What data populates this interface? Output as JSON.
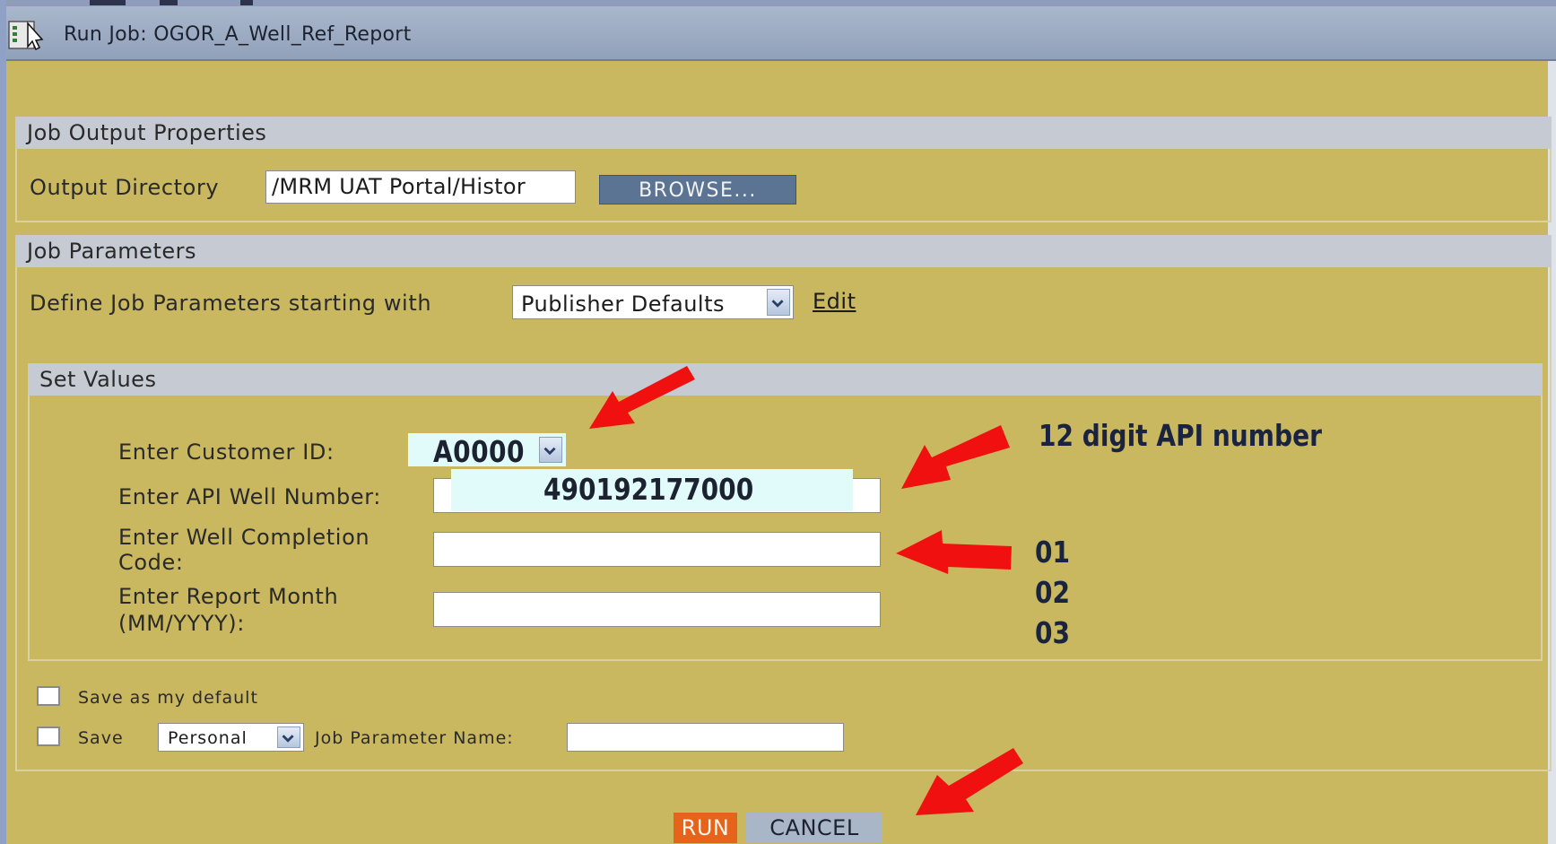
{
  "window": {
    "title": "Run Job: OGOR_A_Well_Ref_Report"
  },
  "job_output": {
    "header": "Job Output Properties",
    "output_directory_label": "Output Directory",
    "output_directory_value": "/MRM UAT Portal/Histor",
    "browse_label": "BROWSE..."
  },
  "job_parameters": {
    "header": "Job Parameters",
    "define_label": "Define Job Parameters starting with",
    "define_selected": "Publisher Defaults",
    "edit_label": "Edit"
  },
  "set_values": {
    "header": "Set Values",
    "customer_id_label": "Enter Customer ID:",
    "customer_id_value": "A0000",
    "api_well_label": "Enter API Well Number:",
    "api_well_value": "490192177000",
    "completion_label_line1": "Enter Well Completion",
    "completion_label_line2": "Code:",
    "completion_value": "",
    "report_month_label_line1": "Enter Report Month",
    "report_month_label_line2": "(MM/YYYY):",
    "report_month_value": ""
  },
  "save_options": {
    "save_default_label": "Save as my default",
    "save_label": "Save",
    "save_scope_selected": "Personal",
    "job_param_name_label": "Job Parameter Name:",
    "job_param_name_value": ""
  },
  "actions": {
    "run_label": "RUN",
    "cancel_label": "CANCEL"
  },
  "annotations": {
    "api_note": "12 digit API number",
    "code_1": "01",
    "code_2": "02",
    "code_3": "03",
    "arrow_color": "#f01010"
  }
}
